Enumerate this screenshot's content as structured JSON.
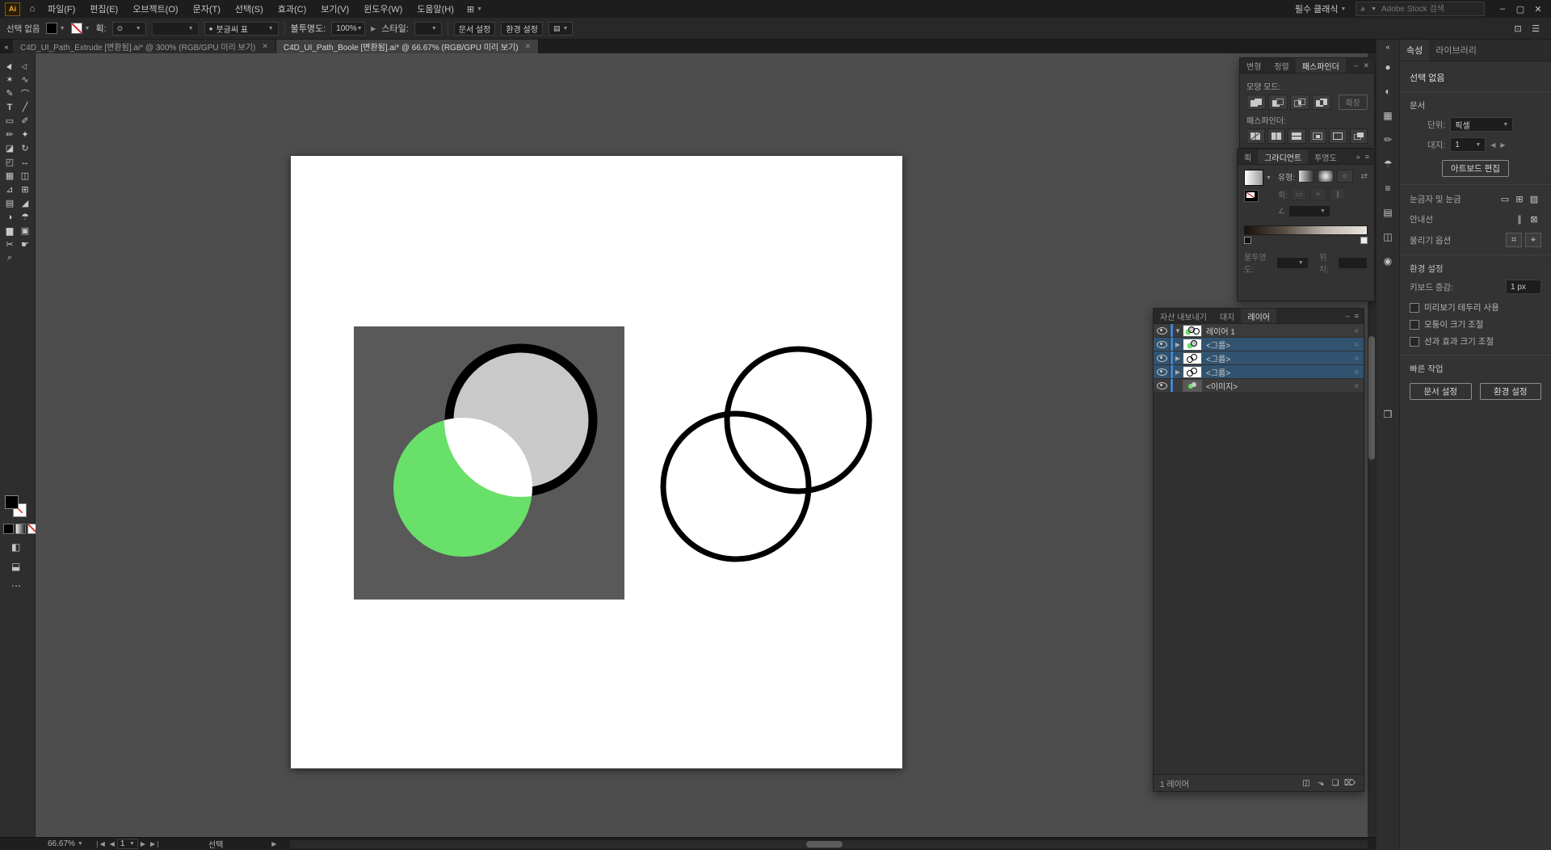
{
  "app": {
    "logo": "Ai"
  },
  "menubar": {
    "items": [
      "파일(F)",
      "편집(E)",
      "오브젝트(O)",
      "문자(T)",
      "선택(S)",
      "효과(C)",
      "보기(V)",
      "윈도우(W)",
      "도움말(H)"
    ],
    "workspace": "필수 클래식",
    "search_placeholder": "Adobe Stock 검색"
  },
  "controlbar": {
    "selection_status": "선택 없음",
    "stroke_label": "획:",
    "brush_name": "붓글씨 표",
    "opacity_label": "불투명도:",
    "opacity_value": "100%",
    "style_label": "스타일:",
    "doc_setup": "문서 설정",
    "preferences": "환경 설정"
  },
  "tabbar": {
    "tabs": [
      {
        "title": "C4D_UI_Path_Extrude  [변환됨].ai* @ 300% (RGB/GPU 미리 보기)"
      },
      {
        "title": "C4D_UI_Path_Boole  [변환됨].ai* @ 66.67% (RGB/GPU 미리 보기)"
      }
    ]
  },
  "pathfinder": {
    "tabs": [
      "변형",
      "정렬",
      "패스파인더"
    ],
    "shape_modes_label": "모양 모드:",
    "expand_button": "확장",
    "pathfinder_label": "패스파인더:"
  },
  "gradient": {
    "tabs": [
      "획",
      "그라디언트",
      "투명도"
    ],
    "type_label": "유형:",
    "stroke_label": "획:",
    "angle_label": "∠",
    "opacity_label": "불투명도:",
    "location_label": "위치:"
  },
  "layers": {
    "tabs": [
      "자산 내보내기",
      "대지",
      "레이어"
    ],
    "rows": [
      {
        "name": "레이어 1"
      },
      {
        "name": "<그룹>"
      },
      {
        "name": "<그룹>"
      },
      {
        "name": "<그룹>"
      },
      {
        "name": "<이미지>"
      }
    ],
    "count_label": "1 레이어"
  },
  "properties": {
    "tabs": [
      "속성",
      "라이브러리"
    ],
    "no_selection": "선택 없음",
    "document_section": "문서",
    "units_label": "단위:",
    "units_value": "픽셀",
    "artboard_label": "대지:",
    "artboard_value": "1",
    "edit_artboards_button": "아트보드 편집",
    "rulers_label": "눈금자 및 눈금",
    "guides_label": "안내선",
    "snap_label": "물리기 옵션",
    "prefs_section": "환경 설정",
    "keyboard_increment_label": "키보드 증감:",
    "keyboard_increment_value": "1 px",
    "checkbox_preview_bounds": "미리보기 테두리 사용",
    "checkbox_scale_corners": "모퉁이 크기 조절",
    "checkbox_scale_strokes": "선과 효과 크기 조절",
    "quick_actions_section": "빠른 작업",
    "doc_setup_button": "문서 설정",
    "preferences_button": "환경 설정"
  },
  "statusbar": {
    "zoom": "66.67%",
    "artboard_number": "1",
    "tool_status": "선택"
  },
  "colors": {
    "accent_blue": "#3f87d2",
    "selected_row": "#31536f",
    "green_circle": "#69e069",
    "gray_circle": "#c9c9c9",
    "square_gray": "#595959"
  }
}
